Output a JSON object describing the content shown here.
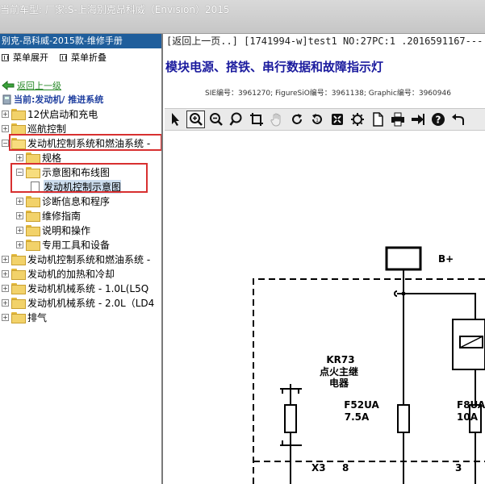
{
  "window": {
    "title": "当前车型:  厂家:S-上海别克昂科威（Envision）2015"
  },
  "left_panel": {
    "title": "别克-昂科威-2015款-维修手册",
    "menu": {
      "expand_label": "菜单展开",
      "collapse_label": "菜单折叠"
    },
    "back_label": "返回上一级",
    "current_label": "当前:发动机/ 推进系统",
    "tree": [
      {
        "label": "12伏启动和充电",
        "level": 0,
        "expanded": false
      },
      {
        "label": "巡航控制",
        "level": 0,
        "expanded": false
      },
      {
        "label": "发动机控制系统和燃油系统 -",
        "level": 0,
        "expanded": true
      },
      {
        "label": "规格",
        "level": 1,
        "expanded": false
      },
      {
        "label": "示意图和布线图",
        "level": 1,
        "expanded": true
      },
      {
        "label": "发动机控制示意图",
        "level": 2,
        "selected": true
      },
      {
        "label": "诊断信息和程序",
        "level": 1,
        "expanded": false
      },
      {
        "label": "维修指南",
        "level": 1,
        "expanded": false
      },
      {
        "label": "说明和操作",
        "level": 1,
        "expanded": false
      },
      {
        "label": "专用工具和设备",
        "level": 1,
        "expanded": false
      },
      {
        "label": "发动机控制系统和燃油系统 -",
        "level": 0,
        "expanded": false
      },
      {
        "label": "发动机的加热和冷却",
        "level": 0,
        "expanded": false
      },
      {
        "label": "发动机机械系统 - 1.0L(L5Q",
        "level": 0,
        "expanded": false
      },
      {
        "label": "发动机机械系统 - 2.0L（LD4",
        "level": 0,
        "expanded": false
      },
      {
        "label": "排气",
        "level": 0,
        "expanded": false
      }
    ]
  },
  "content": {
    "header_line": "[返回上一页..] [1741994-w]test1 NO:27PC:1 .2016591167---",
    "heading": "模块电源、搭铁、串行数据和故障指示灯",
    "meta": "SIE编号：3961270;  FigureSiO编号：3961138;  Graphic编号：3960946"
  },
  "toolbar": [
    {
      "name": "pointer-tool",
      "icon": "arrow-pointer-icon"
    },
    {
      "name": "zoom-in-tool",
      "icon": "zoom-in-icon",
      "active": true
    },
    {
      "name": "zoom-out-tool",
      "icon": "zoom-out-icon"
    },
    {
      "name": "search-tool",
      "icon": "magnifier-icon"
    },
    {
      "name": "crop-tool",
      "icon": "crop-icon"
    },
    {
      "name": "pan-tool",
      "icon": "hand-icon"
    },
    {
      "name": "rotate-tool",
      "icon": "rotate-icon"
    },
    {
      "name": "reset-tool",
      "icon": "reset-icon"
    },
    {
      "name": "fit-tool",
      "icon": "fit-icon"
    },
    {
      "name": "settings-tool",
      "icon": "gear-icon"
    },
    {
      "name": "page-tool",
      "icon": "page-icon"
    },
    {
      "name": "print-tool",
      "icon": "printer-icon"
    },
    {
      "name": "export-tool",
      "icon": "export-icon"
    },
    {
      "name": "help-tool",
      "icon": "help-icon"
    },
    {
      "name": "back-tool",
      "icon": "undo-arrow-icon"
    }
  ],
  "diagram": {
    "battery_label": "B+",
    "relay_id": "KR73",
    "relay_name_line1": "点火主继",
    "relay_name_line2": "电器",
    "fuse1_id": "F52UA",
    "fuse1_rating": "7.5A",
    "fuse2_id": "F8UA",
    "fuse2_rating": "10A",
    "connector": "X3",
    "pin1": "8",
    "pin2": "3"
  },
  "colors": {
    "highlight_box": "#d83030",
    "panel_title_bg": "#1f5e9c",
    "heading": "#1b1b9e"
  }
}
